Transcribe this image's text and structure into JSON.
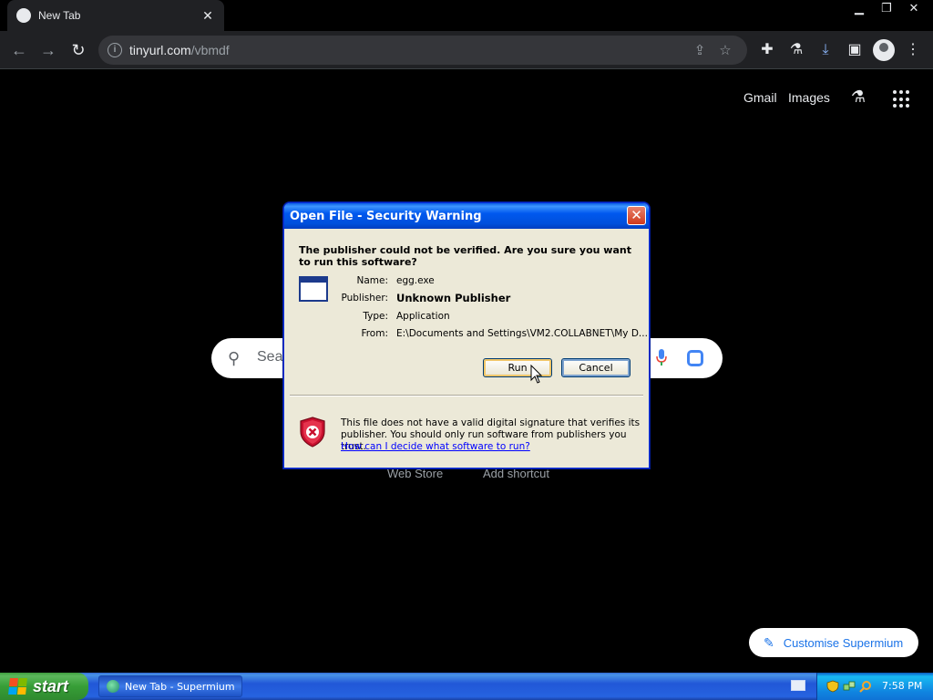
{
  "browser": {
    "tab_title": "New Tab",
    "url_host": "tinyurl.com",
    "url_path": "/vbmdf"
  },
  "page": {
    "top_links": {
      "gmail": "Gmail",
      "images": "Images"
    },
    "search_placeholder": "Sear",
    "shortcuts": {
      "web_store": "Web Store",
      "add_shortcut": "Add shortcut"
    },
    "customise_label": "Customise Supermium"
  },
  "dialog": {
    "title": "Open File - Security Warning",
    "question": "The publisher could not be verified.  Are you sure you want to run this software?",
    "fields": {
      "name_label": "Name:",
      "name_value": "egg.exe",
      "publisher_label": "Publisher:",
      "publisher_value": "Unknown Publisher",
      "type_label": "Type:",
      "type_value": "Application",
      "from_label": "From:",
      "from_value": "E:\\Documents and Settings\\VM2.COLLABNET\\My D..."
    },
    "run_label": "Run",
    "cancel_label": "Cancel",
    "warning": "This file does not have a valid digital signature that verifies its publisher.  You should only run software from publishers you trust.",
    "help_link": "How can I decide what software to run?"
  },
  "taskbar": {
    "start_label": "start",
    "task_label": "New Tab - Supermium",
    "clock": "7:58 PM"
  },
  "colors": {
    "xp_title_blue": "#0058ee",
    "dialog_bg": "#ece9d8",
    "link_blue": "#1a73e8"
  },
  "icons": [
    "back-icon",
    "forward-icon",
    "reload-icon",
    "info-icon",
    "share-icon",
    "star-icon",
    "extensions-icon",
    "labs-icon",
    "download-icon",
    "sidepanel-icon",
    "profile-icon",
    "menu-icon",
    "apps-grid-icon",
    "search-icon",
    "mic-icon",
    "lens-icon",
    "pencil-icon",
    "shield-icon",
    "application-icon"
  ]
}
